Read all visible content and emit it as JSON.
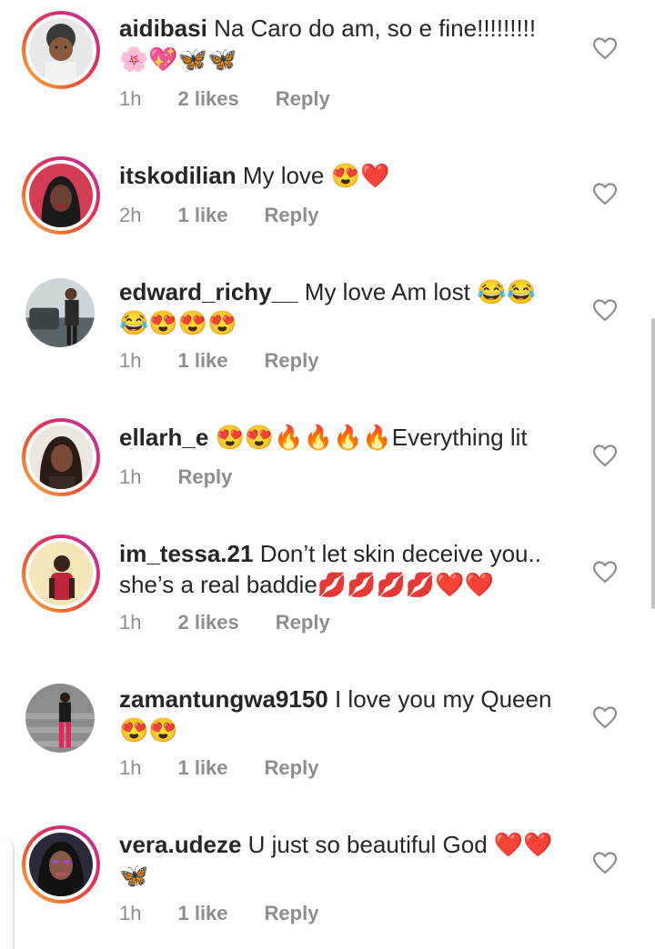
{
  "comments": [
    {
      "username": "aidibasi",
      "text": "Na Caro do am, so e fine!!!!!!!!! 🌸💖🦋🦋",
      "time": "1h",
      "likes": "2 likes",
      "reply": "Reply",
      "story_ring": true
    },
    {
      "username": "itskodilian",
      "text": "My love 😍❤️",
      "time": "2h",
      "likes": "1 like",
      "reply": "Reply",
      "story_ring": true
    },
    {
      "username": "edward_richy__",
      "text": "My love Am lost 😂😂😂😍😍😍",
      "time": "1h",
      "likes": "1 like",
      "reply": "Reply",
      "story_ring": false
    },
    {
      "username": "ellarh_e",
      "text": "😍😍🔥🔥🔥🔥Everything lit",
      "time": "1h",
      "likes": "",
      "reply": "Reply",
      "story_ring": true
    },
    {
      "username": "im_tessa.21",
      "text": "Don’t let skin deceive you.. she’s a real baddie💋💋💋💋❤️❤️",
      "time": "1h",
      "likes": "2 likes",
      "reply": "Reply",
      "story_ring": true
    },
    {
      "username": "zamantungwa9150",
      "text": "I love you my Queen😍😍",
      "time": "1h",
      "likes": "1 like",
      "reply": "Reply",
      "story_ring": false
    },
    {
      "username": "vera.udeze",
      "text": "U just so beautiful God ❤️❤️🦋",
      "time": "1h",
      "likes": "1 like",
      "reply": "Reply",
      "story_ring": true
    }
  ],
  "icons": {
    "like": "heart-outline-icon"
  },
  "colors": {
    "text": "#262626",
    "meta": "#8e8e8e",
    "ring_start": "#f9c34a",
    "ring_end": "#b23ab3"
  }
}
